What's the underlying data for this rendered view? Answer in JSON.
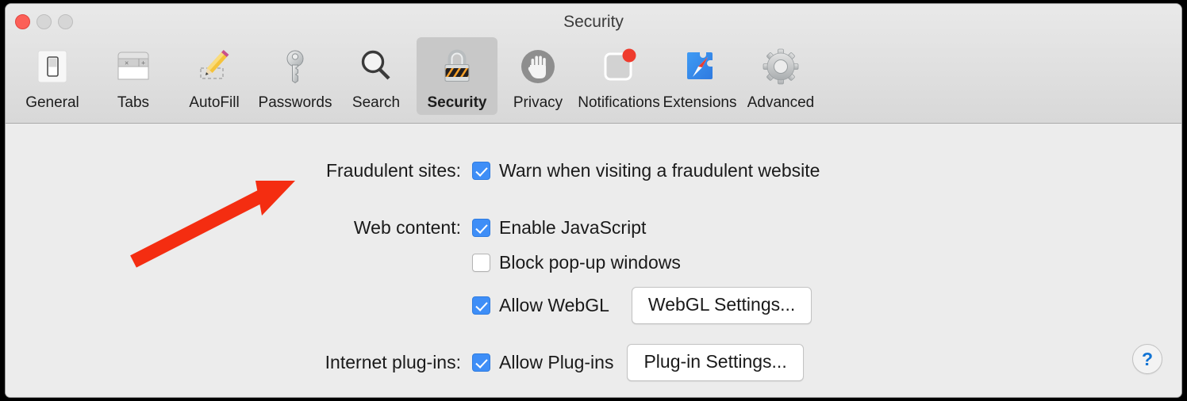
{
  "window": {
    "title": "Security",
    "traffic_lights": [
      {
        "name": "close",
        "color": "#fc5f57",
        "enabled": true
      },
      {
        "name": "minimize",
        "color": "#d6d6d6",
        "enabled": false
      },
      {
        "name": "zoom",
        "color": "#d6d6d6",
        "enabled": false
      }
    ]
  },
  "toolbar": {
    "selected": "Security",
    "items": [
      {
        "label": "General",
        "icon": "light-switch-icon"
      },
      {
        "label": "Tabs",
        "icon": "browser-tabs-icon"
      },
      {
        "label": "AutoFill",
        "icon": "pencil-icon"
      },
      {
        "label": "Passwords",
        "icon": "key-icon"
      },
      {
        "label": "Search",
        "icon": "magnifier-icon"
      },
      {
        "label": "Security",
        "icon": "padlock-icon"
      },
      {
        "label": "Privacy",
        "icon": "hand-icon"
      },
      {
        "label": "Notifications",
        "icon": "notification-badge-icon"
      },
      {
        "label": "Extensions",
        "icon": "puzzle-compass-icon"
      },
      {
        "label": "Advanced",
        "icon": "gear-icon"
      }
    ]
  },
  "preferences": {
    "groups": [
      {
        "label": "Fraudulent sites:",
        "rows": [
          {
            "checkbox_label": "Warn when visiting a fraudulent website",
            "checked": true,
            "button": null
          }
        ]
      },
      {
        "label": "Web content:",
        "rows": [
          {
            "checkbox_label": "Enable JavaScript",
            "checked": true,
            "button": null
          },
          {
            "checkbox_label": "Block pop-up windows",
            "checked": false,
            "button": null
          },
          {
            "checkbox_label": "Allow WebGL",
            "checked": true,
            "button": "WebGL Settings..."
          }
        ]
      },
      {
        "label": "Internet plug-ins:",
        "rows": [
          {
            "checkbox_label": "Allow Plug-ins",
            "checked": true,
            "button": "Plug-in Settings..."
          }
        ]
      }
    ]
  },
  "help": {
    "label": "?"
  },
  "annotation": {
    "type": "arrow",
    "color": "#f42d11",
    "points_at": "Fraudulent sites:"
  },
  "colors": {
    "checkbox_on": "#3e8ef7",
    "help_glyph": "#1274d4",
    "annotation_red": "#f42d11",
    "window_bg": "#ececec",
    "toolbar_selected_bg": "#c8c8c8"
  }
}
